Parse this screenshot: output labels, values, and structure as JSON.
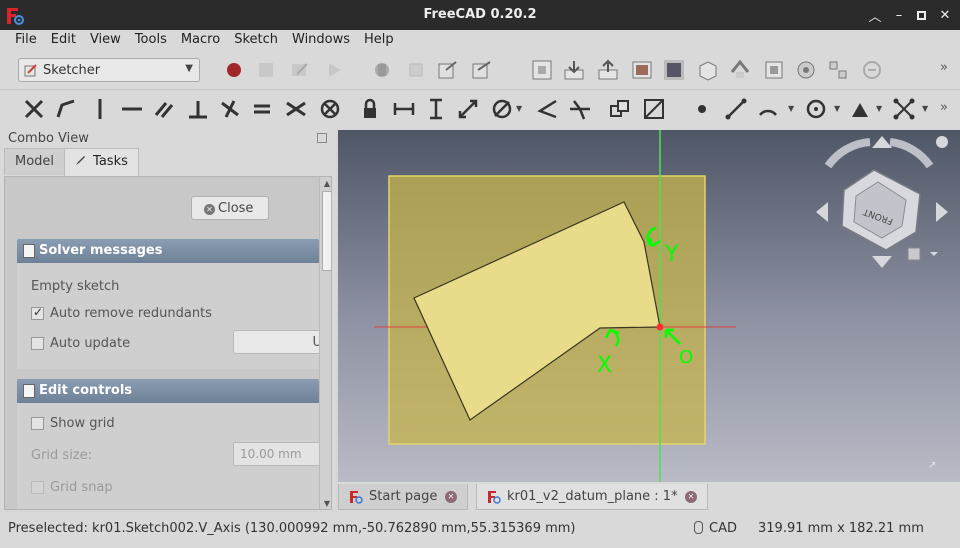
{
  "window": {
    "title": "FreeCAD 0.20.2"
  },
  "menu": [
    "File",
    "Edit",
    "View",
    "Tools",
    "Macro",
    "Sketch",
    "Windows",
    "Help"
  ],
  "workbench": {
    "selected": "Sketcher"
  },
  "combo_view": {
    "title": "Combo View",
    "tabs": [
      {
        "label": "Model"
      },
      {
        "label": "Tasks"
      }
    ],
    "close_label": "Close",
    "solver": {
      "header": "Solver messages",
      "status": "Empty sketch",
      "auto_remove_label": "Auto remove redundants",
      "auto_remove_checked": true,
      "auto_update_label": "Auto update",
      "auto_update_checked": false,
      "update_button": "U"
    },
    "edit_controls": {
      "header": "Edit controls",
      "show_grid_label": "Show grid",
      "grid_size_label": "Grid size:",
      "grid_size_value": "10.00 mm",
      "grid_snap_label": "Grid snap"
    }
  },
  "viewport": {
    "axis_labels": {
      "x": "X",
      "y": "Y",
      "origin": "O"
    },
    "navcube_face": "FRONT",
    "colors": {
      "plane": "#c8b64a",
      "polygon": "#e8dc8a",
      "axis_x": "#e04040",
      "axis_y": "#50e050",
      "labels": "#00ff00"
    }
  },
  "doc_tabs": [
    {
      "label": "Start page"
    },
    {
      "label": "kr01_v2_datum_plane : 1*"
    }
  ],
  "status": {
    "preselected": "Preselected: kr01.Sketch002.V_Axis (130.000992 mm,-50.762890 mm,55.315369 mm)",
    "nav_style": "CAD",
    "dimensions": "319.91 mm x 182.21 mm"
  }
}
